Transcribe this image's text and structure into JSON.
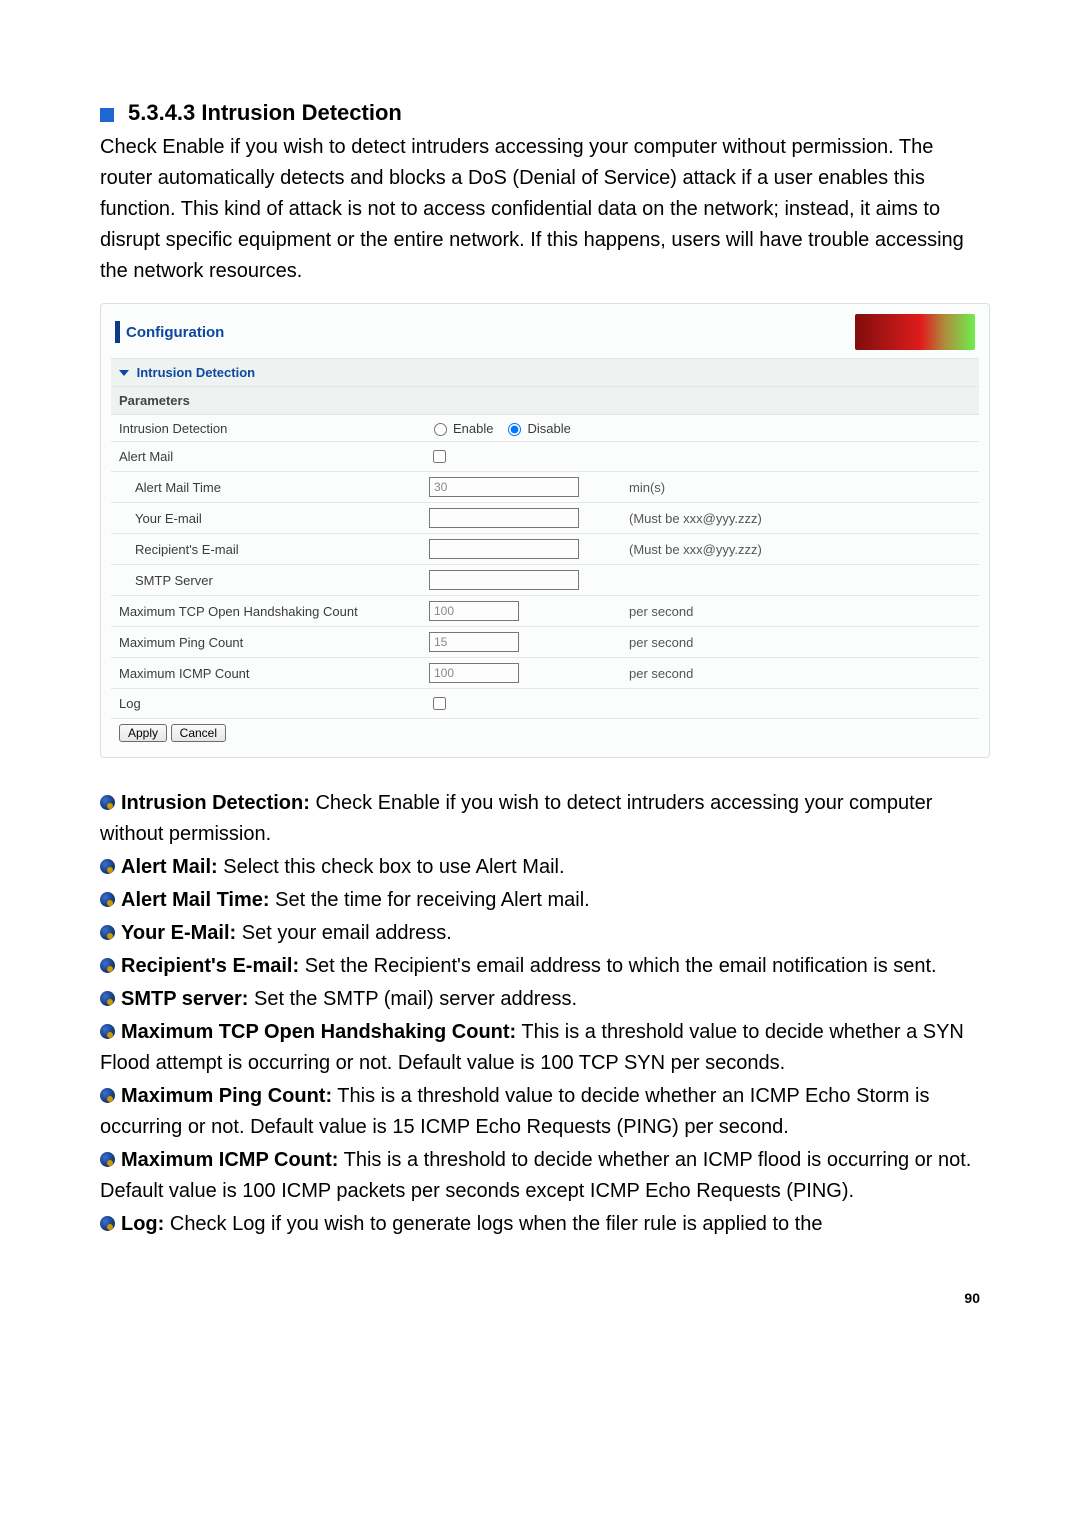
{
  "heading": {
    "number_title": "5.3.4.3 Intrusion Detection"
  },
  "intro_paragraph": "Check Enable if you wish to detect intruders accessing your computer without permission. The router automatically detects and blocks a DoS (Denial of Service) attack if a user enables this function. This kind of attack is not to access confidential data on the network; instead, it aims to disrupt specific equipment or the entire network. If this happens, users will have trouble accessing the network resources.",
  "panel": {
    "config_label": "Configuration",
    "section_link": "Intrusion Detection",
    "parameters_label": "Parameters",
    "rows": {
      "intrusion_detection": {
        "label": "Intrusion Detection",
        "enable": "Enable",
        "disable": "Disable",
        "selected": "disable"
      },
      "alert_mail": {
        "label": "Alert Mail",
        "checked": false
      },
      "alert_mail_time": {
        "label": "Alert Mail Time",
        "value": "30",
        "unit": "min(s)"
      },
      "your_email": {
        "label": "Your E-mail",
        "value": "",
        "hint": "(Must be xxx@yyy.zzz)"
      },
      "recipient_email": {
        "label": "Recipient's E-mail",
        "value": "",
        "hint": "(Must be xxx@yyy.zzz)"
      },
      "smtp_server": {
        "label": "SMTP Server",
        "value": ""
      },
      "max_tcp": {
        "label": "Maximum TCP Open Handshaking Count",
        "value": "100",
        "unit": "per second"
      },
      "max_ping": {
        "label": "Maximum Ping Count",
        "value": "15",
        "unit": "per second"
      },
      "max_icmp": {
        "label": "Maximum ICMP Count",
        "value": "100",
        "unit": "per second"
      },
      "log": {
        "label": "Log",
        "checked": false
      }
    },
    "buttons": {
      "apply": "Apply",
      "cancel": "Cancel"
    }
  },
  "bullets": [
    {
      "term": "Intrusion Detection:",
      "desc": " Check Enable if you wish to detect intruders accessing your computer without permission."
    },
    {
      "term": "Alert Mail:",
      "desc": " Select this check box to use Alert Mail."
    },
    {
      "term": "Alert Mail Time:",
      "desc": " Set the time for receiving Alert mail."
    },
    {
      "term": "Your E-Mail:",
      "desc": " Set your email address."
    },
    {
      "term": "Recipient's E-mail:",
      "desc": " Set the Recipient's email address to which the email notification is sent."
    },
    {
      "term": "SMTP server:",
      "desc": " Set the SMTP (mail) server address."
    },
    {
      "term": "Maximum TCP Open Handshaking Count:",
      "desc": " This is a threshold value to decide whether a SYN Flood attempt is occurring or not. Default value is 100 TCP SYN per seconds."
    },
    {
      "term": "Maximum Ping Count:",
      "desc": " This is a threshold value to decide whether an ICMP Echo Storm is occurring or not. Default value is 15 ICMP Echo Requests (PING) per second."
    },
    {
      "term": "Maximum ICMP Count:",
      "desc": " This is a threshold to decide whether an ICMP flood is occurring or not. Default value is 100 ICMP packets per seconds except ICMP Echo Requests (PING)."
    },
    {
      "term": "Log:",
      "desc": " Check Log if you wish to generate logs when the filer rule is applied to the"
    }
  ],
  "page_number": "90"
}
